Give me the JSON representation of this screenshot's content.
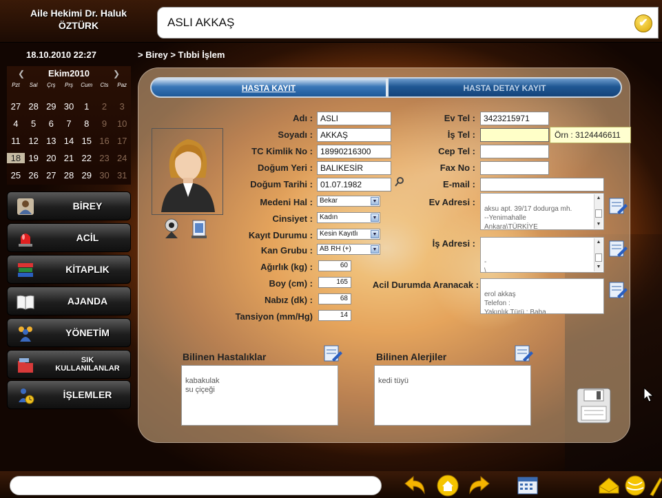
{
  "header": {
    "doctor_line1": "Aile Hekimi Dr. Haluk",
    "doctor_line2": "ÖZTÜRK",
    "patient_name": "ASLI AKKAŞ"
  },
  "datetime": "18.10.2010  22:27",
  "breadcrumb": "> Birey > Tıbbi İşlem",
  "calendar": {
    "month_label": "Ekim2010",
    "prev": "❮",
    "next": "❯",
    "weekdays": [
      "Pzt",
      "Sal",
      "Çrş",
      "Prş",
      "Cum",
      "Cts",
      "Paz"
    ],
    "rows": [
      [
        "27",
        "28",
        "29",
        "30",
        "1",
        "2",
        "3"
      ],
      [
        "4",
        "5",
        "6",
        "7",
        "8",
        "9",
        "10"
      ],
      [
        "11",
        "12",
        "13",
        "14",
        "15",
        "16",
        "17"
      ],
      [
        "18",
        "19",
        "20",
        "21",
        "22",
        "23",
        "24"
      ],
      [
        "25",
        "26",
        "27",
        "28",
        "29",
        "30",
        "31"
      ]
    ]
  },
  "nav": {
    "birey": "BİREY",
    "acil": "ACİL",
    "kitaplik": "KİTAPLIK",
    "ajanda": "AJANDA",
    "yonetim": "YÖNETİM",
    "sik_line1": "SIK",
    "sik_line2": "KULLANILANLAR",
    "islemler": "İŞLEMLER"
  },
  "tabs": {
    "hasta_kayit": "HASTA KAYIT",
    "hasta_detay": "HASTA DETAY KAYIT"
  },
  "form": {
    "adi_label": "Adı :",
    "adi": "ASLI",
    "soyadi_label": "Soyadı :",
    "soyadi": "AKKAŞ",
    "tc_label": "TC Kimlik No :",
    "tc": "18990216300",
    "dogum_yeri_label": "Doğum Yeri :",
    "dogum_yeri": "BALIKESİR",
    "dogum_tarihi_label": "Doğum Tarihi :",
    "dogum_tarihi": "01.07.1982",
    "medeni_label": "Medeni Hal :",
    "medeni": "Bekar",
    "cinsiyet_label": "Cinsiyet :",
    "cinsiyet": "Kadın",
    "kayit_label": "Kayıt Durumu :",
    "kayit": "Kesin Kayıtlı",
    "kan_label": "Kan Grubu :",
    "kan": "AB RH (+)",
    "agirlik_label": "Ağırlık (kg) :",
    "agirlik": "60",
    "boy_label": "Boy (cm) :",
    "boy": "165",
    "nabiz_label": "Nabız (dk) :",
    "nabiz": "68",
    "tansiyon_label": "Tansiyon (mm/Hg)",
    "tansiyon": "14",
    "ev_tel_label": "Ev Tel :",
    "ev_tel": "3423215971",
    "is_tel_label": "İş Tel :",
    "is_tel": "",
    "is_tel_hint": "Örn : 3124446611",
    "cep_tel_label": "Cep Tel :",
    "cep_tel": "",
    "fax_label": "Fax No :",
    "fax": "",
    "email_label": "E-mail :",
    "email": "",
    "ev_adresi_label": "Ev Adresi :",
    "ev_adresi": "aksu apt. 39/17 dodurga mh.\n--Yenimahalle\nAnkara\\TÜRKİYE",
    "is_adresi_label": "İş Adresi :",
    "is_adresi": "\n-\n\\",
    "acil_label": "Acil Durumda Aranacak :",
    "acil": "erol akkaş\nTelefon :\nYakınlık Türü : Baba"
  },
  "hastaliklar": {
    "title": "Bilinen Hastalıklar",
    "text": "kabakulak\nsu çiçeği"
  },
  "alerjiler": {
    "title": "Bilinen Alerjiler",
    "text": "kedi tüyü"
  },
  "colors": {
    "tab_active": "#1d5898",
    "tab_inactive": "#15447a",
    "hint_bg": "#ffffd0",
    "accent_yellow": "#f5c400"
  }
}
